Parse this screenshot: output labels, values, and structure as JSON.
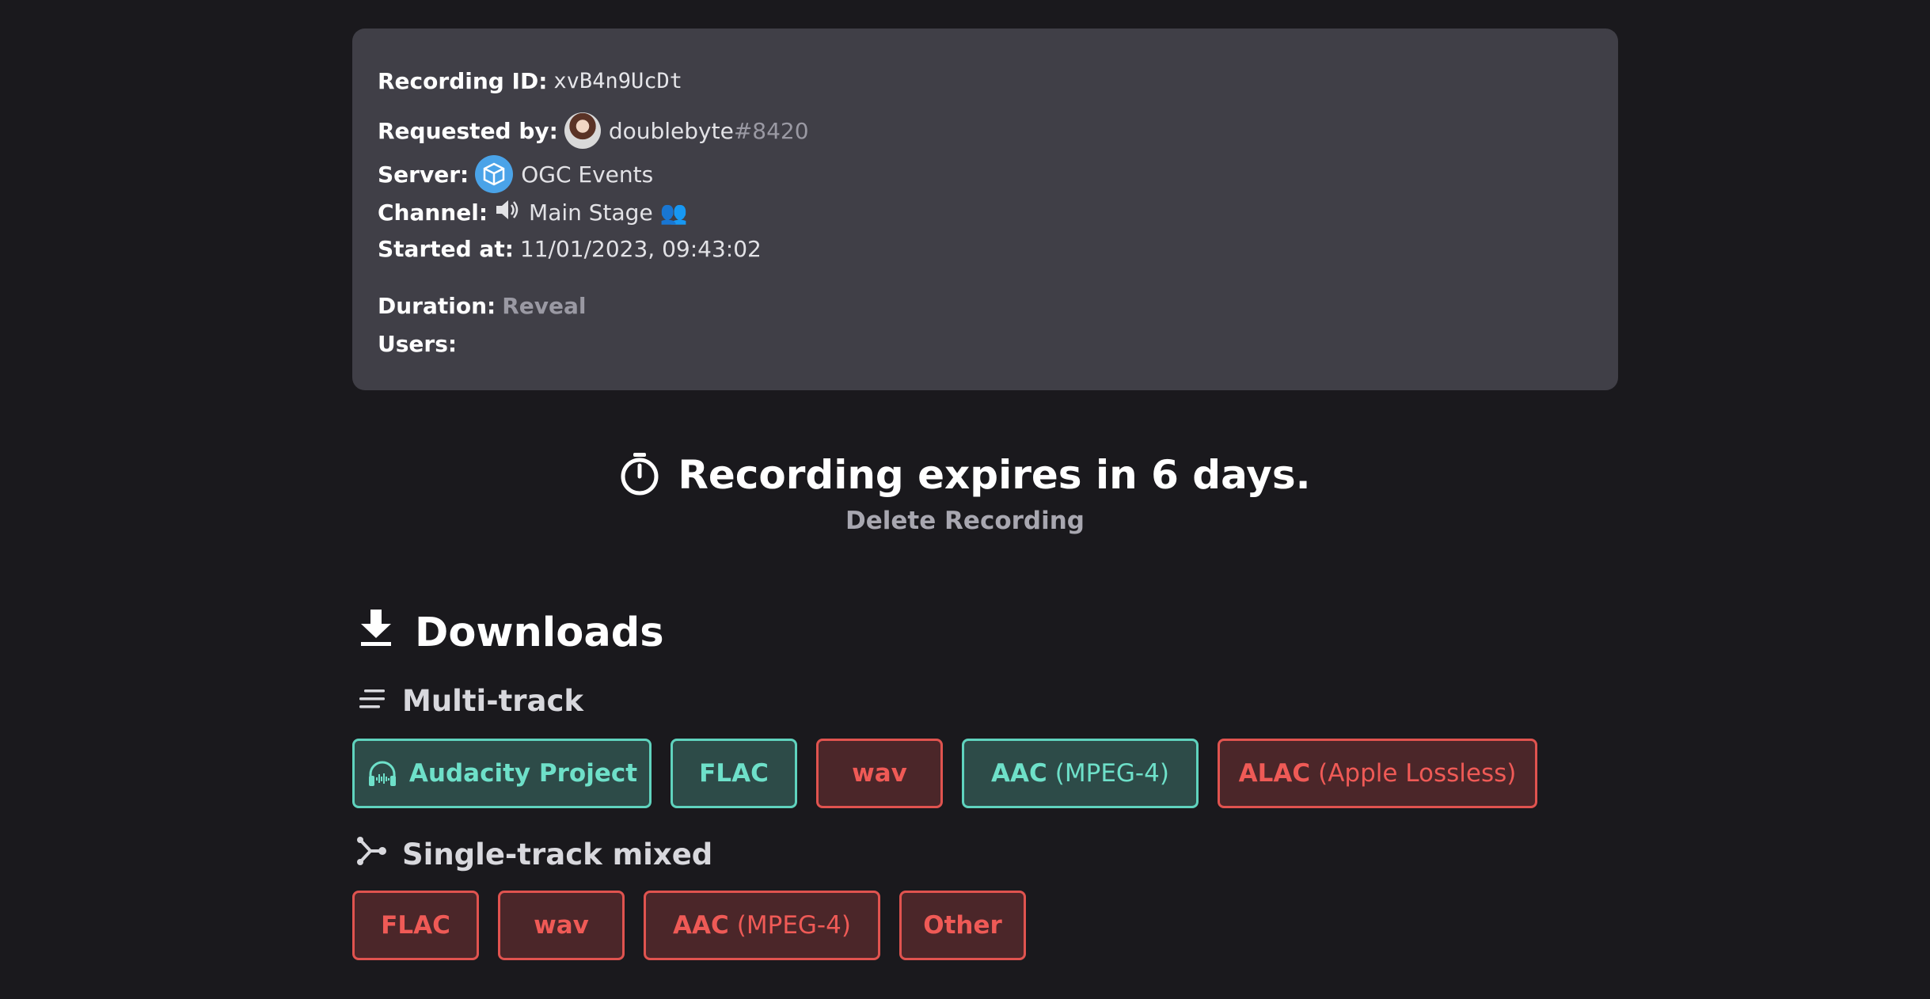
{
  "info": {
    "recording_id_label": "Recording ID:",
    "recording_id": "xvB4n9UcDt",
    "requested_by_label": "Requested by:",
    "requester_name": "doublebyte",
    "requester_tag": "#8420",
    "server_label": "Server:",
    "server_name": "OGC Events",
    "channel_label": "Channel:",
    "channel_name": "Main Stage 👥",
    "started_label": "Started at:",
    "started_value": "11/01/2023, 09:43:02",
    "duration_label": "Duration:",
    "duration_reveal": "Reveal",
    "users_label": "Users:"
  },
  "expiry": {
    "title": "Recording expires in 6 days.",
    "delete_label": "Delete Recording"
  },
  "downloads": {
    "title": "Downloads",
    "multitrack_title": "Multi-track",
    "multitrack_buttons": {
      "audacity": "Audacity Project",
      "flac": "FLAC",
      "wav": "wav",
      "aac": "AAC",
      "aac_sub": "(MPEG-4)",
      "alac": "ALAC",
      "alac_sub": "(Apple Lossless)"
    },
    "singletrack_title": "Single-track mixed",
    "singletrack_buttons": {
      "flac": "FLAC",
      "wav": "wav",
      "aac": "AAC",
      "aac_sub": "(MPEG-4)",
      "other": "Other"
    }
  },
  "colors": {
    "background": "#1a191d",
    "card": "#403f47",
    "available_border": "#5fd3be",
    "unavailable_border": "#e0534f"
  },
  "icons": [
    "avatar",
    "server-icon",
    "speaker-icon",
    "timer-icon",
    "download-icon",
    "multitrack-icon",
    "mixed-icon",
    "headphones-icon"
  ]
}
